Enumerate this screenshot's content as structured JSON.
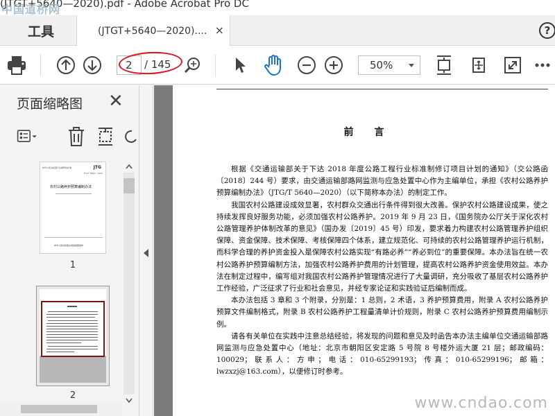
{
  "titlebar": {
    "title": "(JTGT+5640—2020).pdf - Adobe Acrobat Pro DC",
    "watermark": "中国道桥网"
  },
  "tabs": {
    "tools_label": "工具",
    "doc_label": "(JTGT+5640—2020)....",
    "close_glyph": "×",
    "help_glyph": "?"
  },
  "toolbar": {
    "current_page": "2",
    "page_total": "/ 145",
    "zoom": "50%",
    "annotation_color": "#e0121b"
  },
  "sidebar": {
    "title": "页面缩略图",
    "close_glyph": "✕",
    "thumbnails": [
      {
        "label": "1",
        "logo": "JTG",
        "std_line": "中华人民共和国行业推荐性标准",
        "std_no": "JTG/T 5640—2020",
        "book_title": "农村公路养护预算编制办法",
        "publisher": "中华人民共和国交通运输部发布"
      },
      {
        "label": "2"
      }
    ]
  },
  "document": {
    "heading": "前言",
    "paragraphs": [
      "根据《交通运输部关于下达 2018 年度公路工程行业标准制修订项目计划的通知》（交公路函〔2018〕244 号）要求，由交通运输部路网监测与应急处置中心作为主编单位，承担《农村公路养护预算编制办法》（JTG/T 5640—2020）（以下简称本办法）的制定工作。",
      "我国农村公路建设成效显著，农村群众交通出行条件得到很大改善。保护农村公路建设成果，使之持续发挥良好服务功能，必须加强农村公路养护。2019 年 9 月 23 日，《国务院办公厅关于深化农村公路管理养护体制改革的意见》（国办发〔2019〕45 号）印发，要求着力构建农村公路管理养护组织保障、资金保障、技术保障、考核保障四个体系，建立规范化、可持续的农村公路管理养护运行机制，而科学合理的养护资金投入是保障农村公路实现“有路必养”“养必到位”的重要保障。本办法旨在统一农村公路养护预算编制方法，加强农村公路养护费用的计划管理，提高农村公路养护资金使用效益。本办法在制定过程中，编写组对我国农村公路养护管理情况进行了大量调研，充分吸收了基层农村公路养护工作经验，广泛征求了行业和社会意见，并经专家论证和实践验证后编制而成。",
      "本办法包括 3 章和 3 个附录，分别是：1 总则，2 术语，3 养护预算费用，附录 A 农村公路养护预算文件编制格式，附录 B 农村公路养护工程量清单计价规则，附录 C 农村公路养护预算费用编制示例。",
      "请各有关单位在实践中注意总结经验，将发现的问题和意见及时函告本办法主编单位交通运输部路网监测与应急处置中心（地址：北京市朝阳区安定路 5 号院 8 号楼外运大厦 21 层；邮政编码：100029；联系人：方申；电话：010-65299193；传真：010-65299196；邮箱：lwzxzj@163.com），以便修订时参考。"
    ],
    "watermark": "www.cndao.com"
  }
}
